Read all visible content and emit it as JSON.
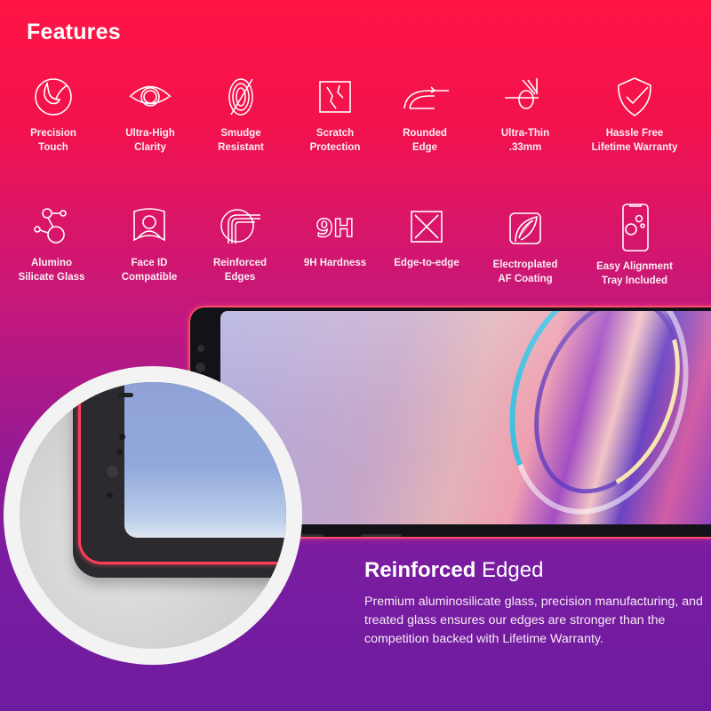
{
  "title": "Features",
  "features_row1": [
    {
      "icon": "precision-touch-icon",
      "label_line1": "Precision",
      "label_line2": "Touch"
    },
    {
      "icon": "eye-icon",
      "label_line1": "Ultra-High",
      "label_line2": "Clarity"
    },
    {
      "icon": "fingerprint-crossed-icon",
      "label_line1": "Smudge",
      "label_line2": "Resistant"
    },
    {
      "icon": "scratch-square-icon",
      "label_line1": "Scratch",
      "label_line2": "Protection"
    },
    {
      "icon": "rounded-edge-icon",
      "label_line1": "Rounded",
      "label_line2": "Edge"
    },
    {
      "icon": "thin-layer-icon",
      "label_line1": "Ultra-Thin",
      "label_line2": ".33mm"
    },
    {
      "icon": "shield-check-icon",
      "label_line1": "Hassle Free",
      "label_line2": "Lifetime Warranty"
    }
  ],
  "features_row2": [
    {
      "icon": "molecule-icon",
      "label_line1": "Alumino",
      "label_line2": "Silicate Glass"
    },
    {
      "icon": "face-id-icon",
      "label_line1": "Face ID",
      "label_line2": "Compatible"
    },
    {
      "icon": "reinforced-edge-icon",
      "label_line1": "Reinforced",
      "label_line2": "Edges"
    },
    {
      "icon": "9h-icon",
      "label_line1": "9H Hardness",
      "label_line2": ""
    },
    {
      "icon": "edge-to-edge-icon",
      "label_line1": "Edge-to-edge",
      "label_line2": ""
    },
    {
      "icon": "coating-icon",
      "label_line1": "Electroplated",
      "label_line2": "AF Coating"
    },
    {
      "icon": "phone-alignment-icon",
      "label_line1": "Easy Alignment",
      "label_line2": "Tray Included"
    }
  ],
  "icon_9h_text": "9H",
  "heading": {
    "bold": "Reinforced",
    "light": "Edged"
  },
  "description": "Premium aluminosilicate glass, precision manufacturing, and treated glass ensures our edges are stronger than the competition backed with Lifetime Warranty.",
  "colors": {
    "top": "#ff1444",
    "bottom": "#6e1c9f",
    "edge_glow": "#ff3d5a"
  }
}
